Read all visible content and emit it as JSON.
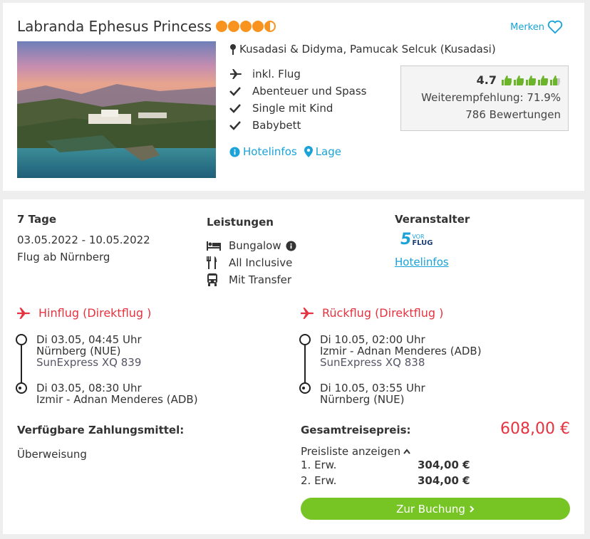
{
  "hotel": {
    "name": "Labranda Ephesus Princess",
    "stars": 4.5,
    "merken_label": "Merken",
    "location": "Kusadasi & Didyma, Pamucak Selcuk (Kusadasi)",
    "features": [
      "inkl. Flug",
      "Abenteuer und Spass",
      "Single mit Kind",
      "Babybett"
    ],
    "links": {
      "hotelinfos": "Hotelinfos",
      "lage": "Lage"
    },
    "rating": {
      "score": "4.7",
      "thumbs_rating": 4.7,
      "recommendation": "Weiterempfehlung: 71.9%",
      "reviews": "786 Bewertungen"
    }
  },
  "offer": {
    "duration": "7 Tage",
    "dates": "03.05.2022 - 10.05.2022",
    "departure": "Flug ab Nürnberg",
    "services_title": "Leistungen",
    "services": [
      "Bungalow",
      "All Inclusive",
      "Mit Transfer"
    ],
    "operator_title": "Veranstalter",
    "operator_logo_text": {
      "digit": "5",
      "top": "VOR",
      "bottom": "FLUG"
    },
    "operator_link": "Hotelinfos",
    "outbound": {
      "title": "Hinflug (Direktflug )",
      "dep_time": "Di 03.05, 04:45 Uhr",
      "dep_airport": "Nürnberg (NUE)",
      "carrier": "SunExpress XQ 839",
      "arr_time": "Di 03.05, 08:30 Uhr",
      "arr_airport": "Izmir - Adnan Menderes (ADB)"
    },
    "return": {
      "title": "Rückflug (Direktflug )",
      "dep_time": "Di 10.05, 02:00 Uhr",
      "dep_airport": "Izmir - Adnan Menderes (ADB)",
      "carrier": "SunExpress XQ 838",
      "arr_time": "Di 10.05, 03:55 Uhr",
      "arr_airport": "Nürnberg (NUE)"
    },
    "payment_title": "Verfügbare Zahlungsmittel:",
    "payment_method": "Überweisung",
    "total_label": "Gesamtreisepreis:",
    "total_price": "608,00 €",
    "pricelist_label": "Preisliste anzeigen",
    "price_rows": [
      {
        "label": "1. Erw.",
        "value": "304,00 €"
      },
      {
        "label": "2. Erw.",
        "value": "304,00 €"
      }
    ],
    "booking_button": "Zur Buchung"
  },
  "colors": {
    "accent_blue": "#1aa3d9",
    "price_red": "#e5333f",
    "button_green": "#76c524",
    "star_orange": "#f7931e",
    "thumb_green": "#6cb52b"
  }
}
